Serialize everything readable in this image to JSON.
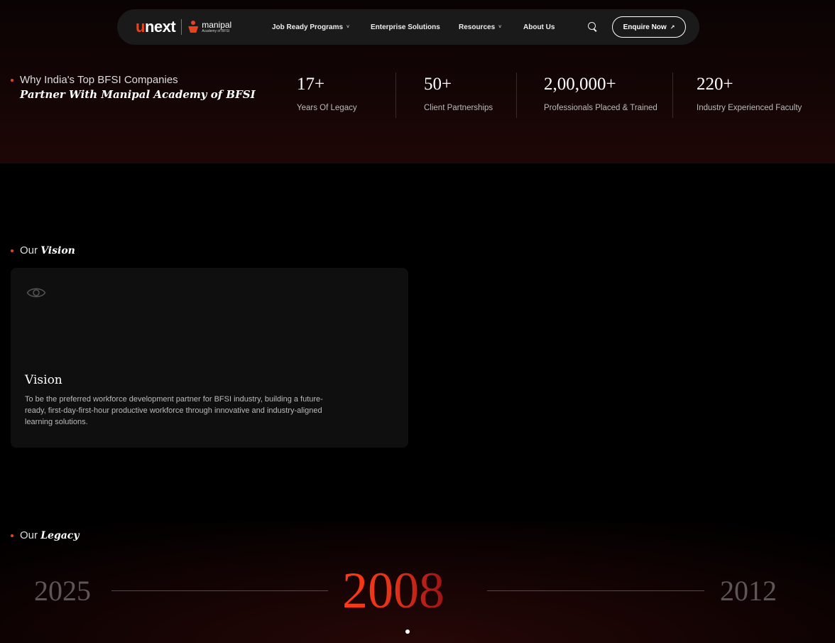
{
  "nav": {
    "logo_unext": "unext",
    "logo_manipal": "manipal",
    "logo_manipal_sub": "Academy of BFSI",
    "items": [
      {
        "label": "Job Ready Programs",
        "has_dropdown": true
      },
      {
        "label": "Enterprise Solutions",
        "has_dropdown": false
      },
      {
        "label": "Resources",
        "has_dropdown": true
      },
      {
        "label": "About Us",
        "has_dropdown": false
      }
    ],
    "dropdown_glyph": "˅",
    "search_icon": "search-icon",
    "cta_label": "Enquire Now",
    "cta_arrow": "↗"
  },
  "why": {
    "line1": "Why India's Top BFSI Companies",
    "line2": "Partner With Manipal Academy of BFSI"
  },
  "stats": [
    {
      "value": "17+",
      "label": "Years Of Legacy"
    },
    {
      "value": "50+",
      "label": "Client Partnerships"
    },
    {
      "value": "2,00,000+",
      "label": "Professionals Placed & Trained"
    },
    {
      "value": "220+",
      "label": "Industry Experienced Faculty"
    }
  ],
  "vision": {
    "section_prefix": "Our",
    "section_emphasis": "Vision",
    "icon": "eye-icon",
    "card_title": "Vision",
    "card_text": "To be the preferred workforce development partner for BFSI industry, building a future-ready, first-day-first-hour productive workforce through innovative and industry-aligned learning solutions."
  },
  "legacy": {
    "section_prefix": "Our",
    "section_emphasis": "Legacy",
    "prev_year": "2025",
    "current_year": "2008",
    "next_year": "2012"
  },
  "colors": {
    "accent": "#e8431f",
    "background": "#000000",
    "card": "#0f0f0f",
    "nav": "#1a1a1a"
  }
}
